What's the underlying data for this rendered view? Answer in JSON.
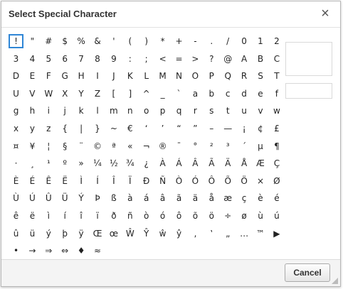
{
  "dialog": {
    "title": "Select Special Character",
    "close_glyph": "×",
    "cancel_label": "Cancel"
  },
  "characters": [
    [
      "!",
      "\"",
      "#",
      "$",
      "%",
      "&",
      "'",
      "(",
      ")",
      "*",
      "+",
      "-",
      ".",
      "/",
      "0",
      "1",
      "2"
    ],
    [
      "3",
      "4",
      "5",
      "6",
      "7",
      "8",
      "9",
      ":",
      ";",
      "<",
      "=",
      ">",
      "?",
      "@",
      "A",
      "B",
      "C"
    ],
    [
      "D",
      "E",
      "F",
      "G",
      "H",
      "I",
      "J",
      "K",
      "L",
      "M",
      "N",
      "O",
      "P",
      "Q",
      "R",
      "S",
      "T"
    ],
    [
      "U",
      "V",
      "W",
      "X",
      "Y",
      "Z",
      "[",
      "]",
      "^",
      "_",
      "`",
      "a",
      "b",
      "c",
      "d",
      "e",
      "f"
    ],
    [
      "g",
      "h",
      "i",
      "j",
      "k",
      "l",
      "m",
      "n",
      "o",
      "p",
      "q",
      "r",
      "s",
      "t",
      "u",
      "v",
      "w"
    ],
    [
      "x",
      "y",
      "z",
      "{",
      "|",
      "}",
      "~",
      "€",
      "‘",
      "’",
      "“",
      "”",
      "–",
      "—",
      "¡",
      "¢",
      "£"
    ],
    [
      "¤",
      "¥",
      "¦",
      "§",
      "¨",
      "©",
      "ª",
      "«",
      "¬",
      "®",
      "¯",
      "°",
      "²",
      "³",
      "´",
      "µ",
      "¶"
    ],
    [
      "·",
      "¸",
      "¹",
      "º",
      "»",
      "¼",
      "½",
      "¾",
      "¿",
      "À",
      "Á",
      "Â",
      "Ã",
      "Ä",
      "Å",
      "Æ",
      "Ç"
    ],
    [
      "È",
      "É",
      "Ê",
      "Ë",
      "Ì",
      "Í",
      "Î",
      "Ï",
      "Ð",
      "Ñ",
      "Ò",
      "Ó",
      "Ô",
      "Õ",
      "Ö",
      "×",
      "Ø"
    ],
    [
      "Ù",
      "Ú",
      "Û",
      "Ü",
      "Ý",
      "Þ",
      "ß",
      "à",
      "á",
      "â",
      "ã",
      "ä",
      "å",
      "æ",
      "ç",
      "è",
      "é"
    ],
    [
      "ê",
      "ë",
      "ì",
      "í",
      "î",
      "ï",
      "ð",
      "ñ",
      "ò",
      "ó",
      "ô",
      "õ",
      "ö",
      "÷",
      "ø",
      "ù",
      "ú"
    ],
    [
      "û",
      "ü",
      "ý",
      "þ",
      "ÿ",
      "Œ",
      "œ",
      "Ŵ",
      "Ŷ",
      "ŵ",
      "ŷ",
      "‚",
      "‛",
      "„",
      "…",
      "™",
      "▶"
    ],
    [
      "•",
      "→",
      "⇒",
      "⇔",
      "♦",
      "≈"
    ]
  ],
  "selected_character": "!"
}
